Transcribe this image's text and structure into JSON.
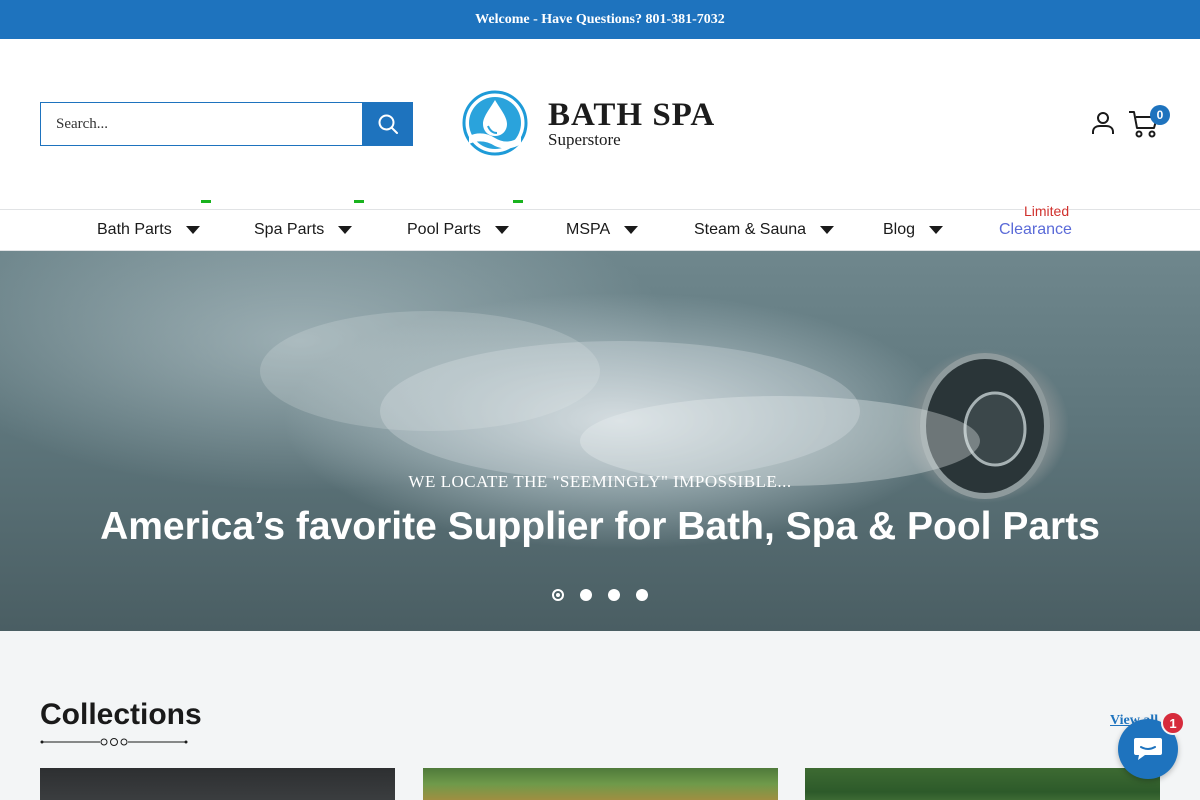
{
  "announcement": {
    "text": "Welcome - Have Questions? 801-381-7032"
  },
  "header": {
    "search": {
      "placeholder": "Search..."
    },
    "logo": {
      "title": "BATH SPA",
      "subtitle": "Superstore"
    },
    "cart_count": "0"
  },
  "nav": {
    "items": [
      {
        "label": "Bath Parts",
        "dropdown": true
      },
      {
        "label": "Spa Parts",
        "dropdown": true
      },
      {
        "label": "Pool Parts",
        "dropdown": true
      },
      {
        "label": "MSPA",
        "dropdown": true
      },
      {
        "label": "Steam & Sauna",
        "dropdown": true
      },
      {
        "label": "Blog",
        "dropdown": true
      },
      {
        "label": "Clearance",
        "badge": "Limited"
      }
    ]
  },
  "hero": {
    "eyebrow": "WE LOCATE THE \"SEEMINGLY\" IMPOSSIBLE...",
    "title": "America’s favorite Supplier for Bath, Spa & Pool Parts",
    "slides": 4,
    "active_slide": 1
  },
  "collections": {
    "title": "Collections",
    "view_all": "View all"
  },
  "chat": {
    "unread": "1"
  },
  "colors": {
    "brand_blue": "#1e73be",
    "badge_red": "#d62b3c",
    "clearance_blue": "#5a6ad8",
    "limited_red": "#d0312d",
    "accent_green": "#19b31e"
  }
}
